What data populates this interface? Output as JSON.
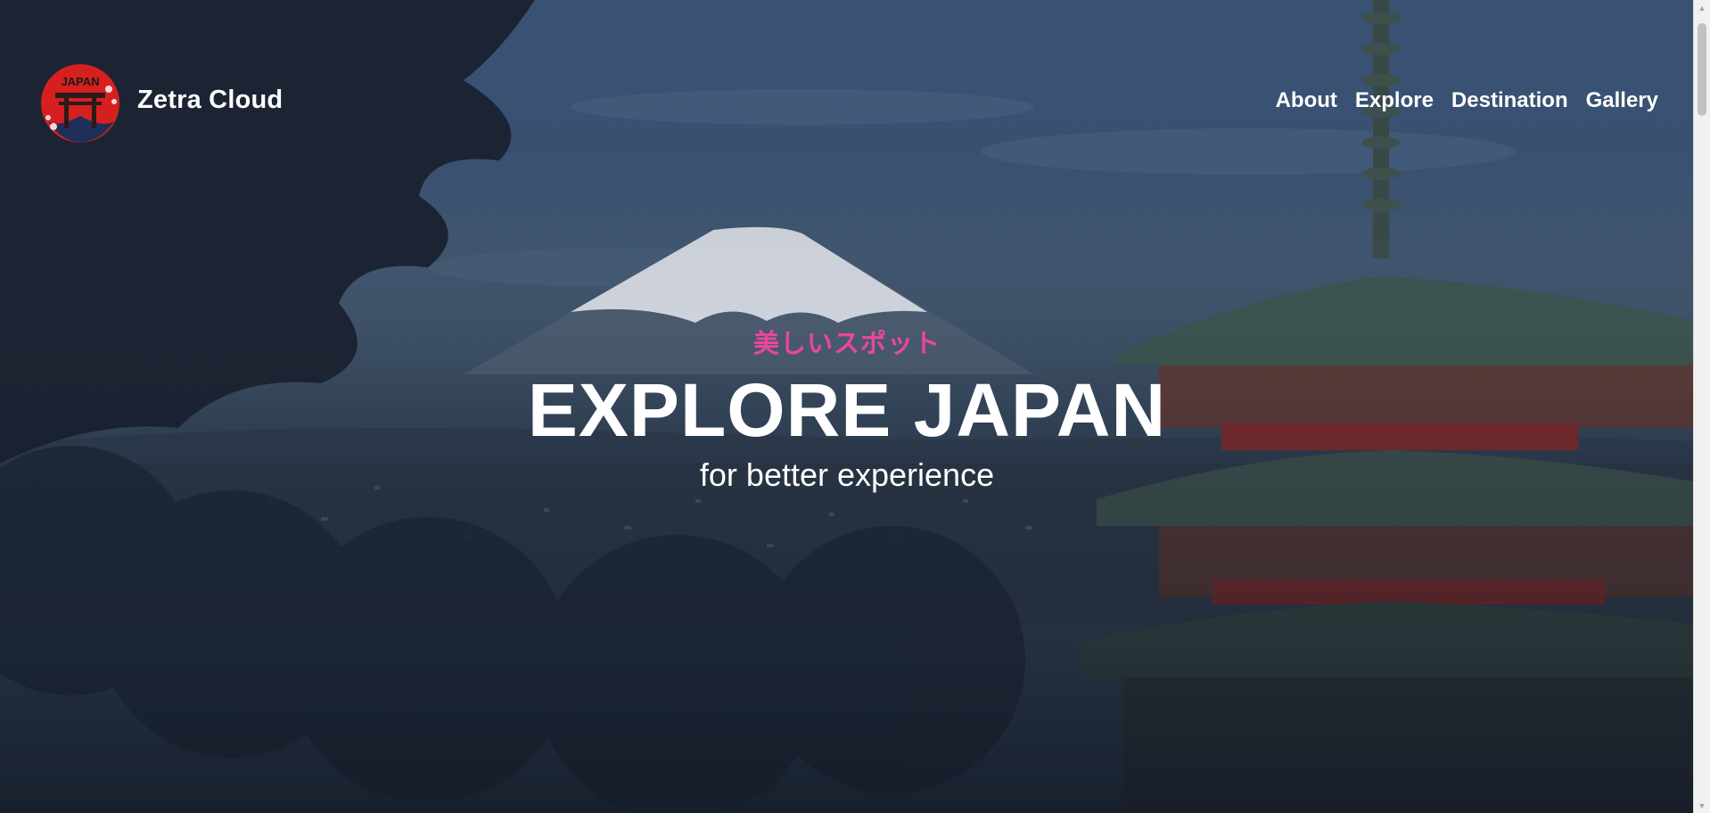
{
  "header": {
    "brand_name": "Zetra Cloud",
    "logo_text": "JAPAN",
    "nav": [
      {
        "label": "About"
      },
      {
        "label": "Explore"
      },
      {
        "label": "Destination"
      },
      {
        "label": "Gallery"
      }
    ]
  },
  "hero": {
    "kicker": "美しいスポット",
    "title": "EXPLORE JAPAN",
    "subtitle": "for better experience"
  },
  "colors": {
    "accent_pink": "#e8479a",
    "text": "#ffffff",
    "bg_dark": "#141b28",
    "sky": "#3b5578"
  },
  "icons": {
    "logo": "torii-gate-logo-icon",
    "scroll_up": "chevron-up-icon",
    "scroll_down": "chevron-down-icon"
  }
}
